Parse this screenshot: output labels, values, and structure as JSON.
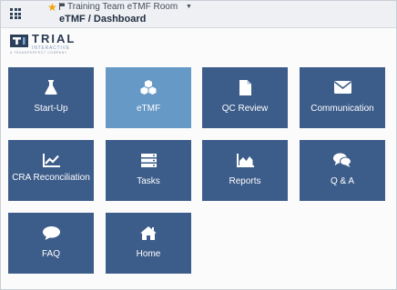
{
  "header": {
    "room_name": "Training Team eTMF Room",
    "page_title": "eTMF / Dashboard"
  },
  "logo": {
    "name": "TRIAL",
    "subname": "INTERACTIVE",
    "tagline": "A TRANSPERFECT COMPANY"
  },
  "colors": {
    "tile": "#3c5c8a",
    "tile_active": "#6799c6",
    "star": "#f2a20b"
  },
  "tiles": [
    {
      "label": "Start-Up",
      "icon": "flask-icon"
    },
    {
      "label": "eTMF",
      "icon": "cubes-icon",
      "active": true
    },
    {
      "label": "QC Review",
      "icon": "file-icon"
    },
    {
      "label": "Communication",
      "icon": "envelope-icon"
    },
    {
      "label": "CRA Reconciliation",
      "icon": "line-chart-icon"
    },
    {
      "label": "Tasks",
      "icon": "server-icon"
    },
    {
      "label": "Reports",
      "icon": "area-chart-icon"
    },
    {
      "label": "Q & A",
      "icon": "comments-icon"
    },
    {
      "label": "FAQ",
      "icon": "comment-icon"
    },
    {
      "label": "Home",
      "icon": "home-icon"
    }
  ]
}
